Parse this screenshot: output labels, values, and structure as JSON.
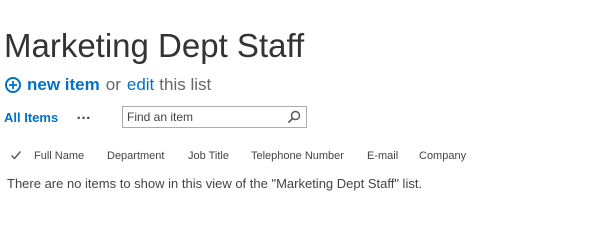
{
  "page": {
    "title": "Marketing Dept Staff"
  },
  "actions": {
    "new_item_label": "new item",
    "or_text": "or",
    "edit_label": "edit",
    "this_list_text": "this list"
  },
  "views": {
    "current_view": "All Items",
    "more_label": "…"
  },
  "search": {
    "placeholder": "Find an item",
    "value": ""
  },
  "list": {
    "columns": [
      "Full Name",
      "Department",
      "Job Title",
      "Telephone Number",
      "E-mail",
      "Company"
    ],
    "empty_message": "There are no items to show in this view of the \"Marketing Dept Staff\" list."
  },
  "icons": {
    "new_item": "plus-circle-icon",
    "search": "search-icon",
    "select_all": "checkmark-icon"
  },
  "colors": {
    "accent": "#0072c6",
    "title": "#333333",
    "text": "#444444",
    "border": "#ababab"
  }
}
